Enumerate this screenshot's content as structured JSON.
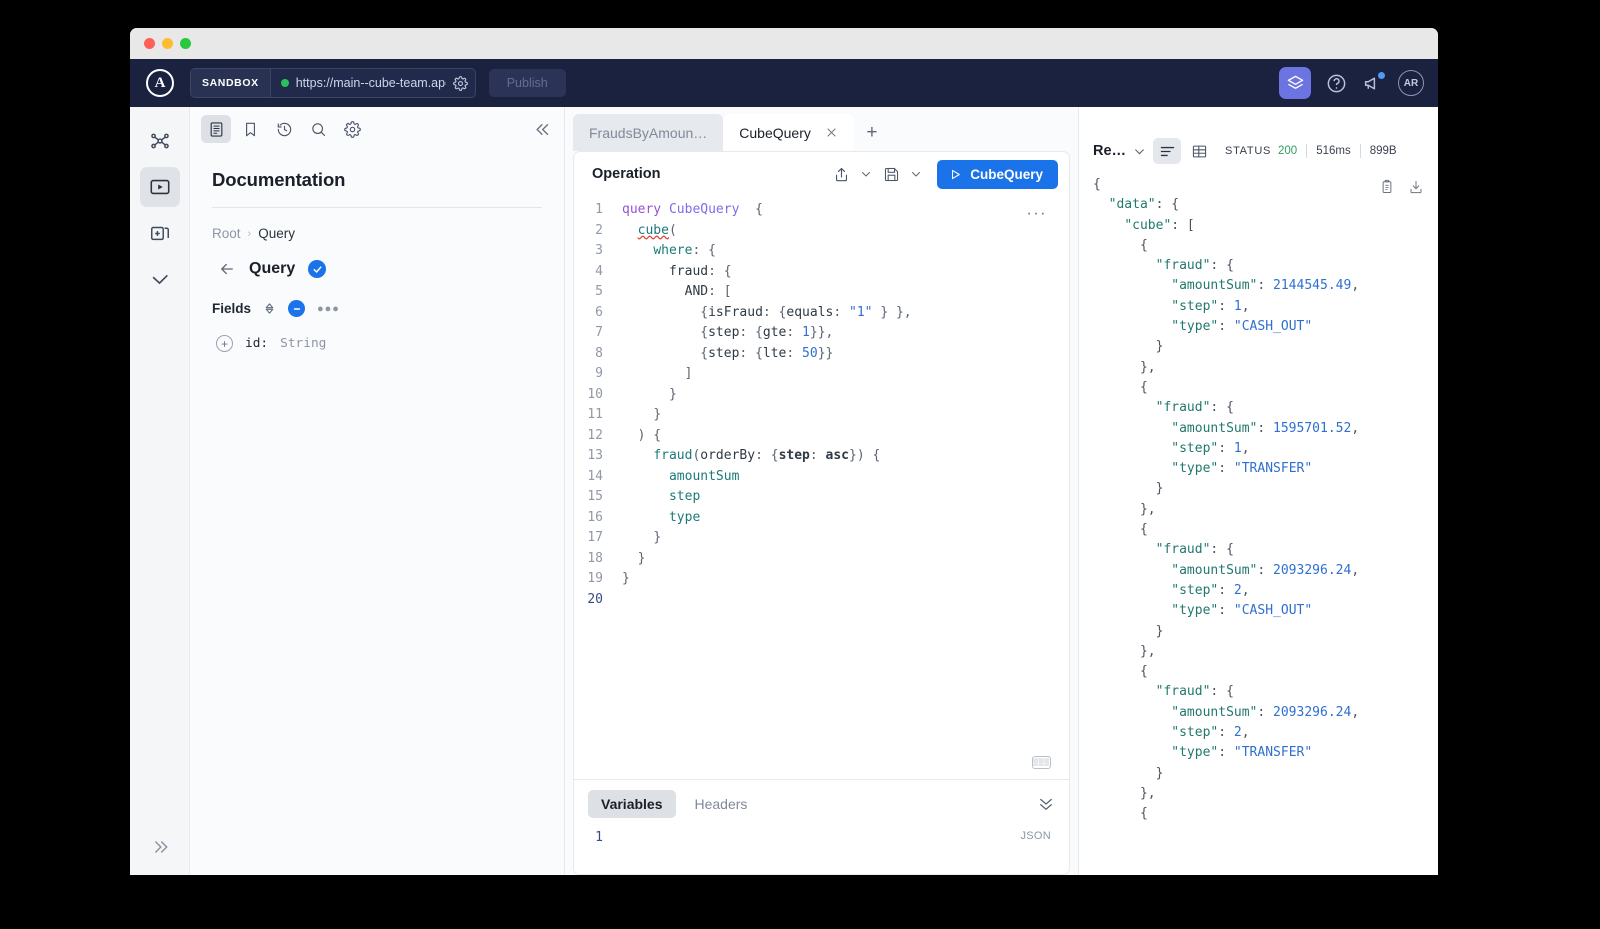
{
  "window": {
    "traffic_lights": [
      "close",
      "minimize",
      "maximize"
    ]
  },
  "appbar": {
    "logo": "apollo-logo",
    "sandbox_label": "SANDBOX",
    "url": "https://main--cube-team.apol",
    "url_settings_icon": "gear-icon",
    "publish_label": "Publish",
    "cube_icon": "cube-icon",
    "help_icon": "help-circle-icon",
    "announcements_icon": "megaphone-icon",
    "avatar_initials": "AR"
  },
  "doc_toolbar": {
    "items": [
      {
        "name": "documentation",
        "icon": "document-icon",
        "active": true
      },
      {
        "name": "saved-operations",
        "icon": "bookmark-icon",
        "active": false
      },
      {
        "name": "history",
        "icon": "history-icon",
        "active": false
      },
      {
        "name": "search",
        "icon": "search-icon",
        "active": false
      },
      {
        "name": "settings",
        "icon": "gear-icon",
        "active": false
      }
    ],
    "collapse_icon": "chevron-double-left-icon"
  },
  "rail": {
    "items": [
      {
        "name": "schema",
        "icon": "graph-icon",
        "active": false
      },
      {
        "name": "explorer",
        "icon": "play-box-icon",
        "active": true
      },
      {
        "name": "changelog",
        "icon": "stacked-cards-icon",
        "active": false
      },
      {
        "name": "checks",
        "icon": "check-icon",
        "active": false
      }
    ],
    "expand_icon": "chevron-double-right-icon"
  },
  "documentation": {
    "title": "Documentation",
    "breadcrumb": {
      "root": "Root",
      "separator": "›",
      "current": "Query"
    },
    "type_name": "Query",
    "type_badge_icon": "check-circle-icon",
    "back_icon": "arrow-left-icon",
    "fields_label": "Fields",
    "sort_icon": "sort-icon",
    "collapse_badge_icon": "minus-circle-icon",
    "more_icon": "ellipsis-icon",
    "fields": [
      {
        "name": "id:",
        "type": "String",
        "add_icon": "plus-circle-icon"
      }
    ]
  },
  "tabs": [
    {
      "label": "FraudsByAmoun…",
      "active": false,
      "closable": false
    },
    {
      "label": "CubeQuery",
      "active": true,
      "closable": true,
      "close_icon": "close-icon"
    }
  ],
  "new_tab_icon": "plus-icon",
  "operation": {
    "title": "Operation",
    "share_icon": "share-icon",
    "share_chevron": "chevron-down-icon",
    "save_icon": "floppy-disk-icon",
    "save_chevron": "chevron-down-icon",
    "run_label": "CubeQuery",
    "run_icon": "play-icon",
    "more_icon": "ellipsis-icon",
    "keyboard_icon": "keyboard-icon",
    "line_count": 20,
    "code_lines": [
      {
        "n": 1,
        "html": "<span class='t-kw'>query</span> <span class='t-opname'>CubeQuery</span>  <span class='t-punct'>{</span>"
      },
      {
        "n": 2,
        "html": "  <span class='t-field squiggle'>cube</span><span class='t-punct'>(</span>"
      },
      {
        "n": 3,
        "html": "    <span class='t-field'>where</span><span class='t-punct'>: {</span>"
      },
      {
        "n": 4,
        "html": "      <span class='t-arg'>fraud</span><span class='t-punct'>: {</span>"
      },
      {
        "n": 5,
        "html": "        <span class='t-arg'>AND</span><span class='t-punct'>: [</span>"
      },
      {
        "n": 6,
        "html": "          <span class='t-punct'>{</span><span class='t-arg'>isFraud</span><span class='t-punct'>: {</span><span class='t-arg'>equals</span><span class='t-punct'>: </span><span class='t-str'>\"1\"</span><span class='t-punct'> } },</span>"
      },
      {
        "n": 7,
        "html": "          <span class='t-punct'>{</span><span class='t-arg'>step</span><span class='t-punct'>: {</span><span class='t-arg'>gte</span><span class='t-punct'>: </span><span class='t-num'>1</span><span class='t-punct'>}},</span>"
      },
      {
        "n": 8,
        "html": "          <span class='t-punct'>{</span><span class='t-arg'>step</span><span class='t-punct'>: {</span><span class='t-arg'>lte</span><span class='t-punct'>: </span><span class='t-num'>50</span><span class='t-punct'>}}</span>"
      },
      {
        "n": 9,
        "html": "        <span class='t-punct'>]</span>"
      },
      {
        "n": 10,
        "html": "      <span class='t-punct'>}</span>"
      },
      {
        "n": 11,
        "html": "    <span class='t-punct'>}</span>"
      },
      {
        "n": 12,
        "html": "  <span class='t-punct'>) {</span>"
      },
      {
        "n": 13,
        "html": "    <span class='t-field'>fraud</span><span class='t-punct'>(</span><span class='t-arg'>orderBy</span><span class='t-punct'>: {</span><span class='t-bold'>step</span><span class='t-punct'>: </span><span class='t-bold'>asc</span><span class='t-punct'>}) {</span>"
      },
      {
        "n": 14,
        "html": "      <span class='t-field'>amountSum</span>"
      },
      {
        "n": 15,
        "html": "      <span class='t-field'>step</span>"
      },
      {
        "n": 16,
        "html": "      <span class='t-field'>type</span>"
      },
      {
        "n": 17,
        "html": "    <span class='t-punct'>}</span>"
      },
      {
        "n": 18,
        "html": "  <span class='t-punct'>}</span>"
      },
      {
        "n": 19,
        "html": "<span class='t-punct'>}</span>"
      },
      {
        "n": 20,
        "html": ""
      }
    ]
  },
  "variables": {
    "tabs": [
      {
        "label": "Variables",
        "active": true
      },
      {
        "label": "Headers",
        "active": false
      }
    ],
    "collapse_icon": "chevron-double-down-icon",
    "format_label": "JSON",
    "line_numbers": [
      1
    ],
    "content": ""
  },
  "response": {
    "title": "Re…",
    "title_chevron": "chevron-down-icon",
    "view_toggle": [
      {
        "name": "json-view",
        "icon": "lines-icon",
        "active": true
      },
      {
        "name": "table-view",
        "icon": "table-icon",
        "active": false
      }
    ],
    "status_label": "STATUS",
    "status_code": "200",
    "duration": "516ms",
    "size": "899B",
    "copy_icon": "clipboard-icon",
    "download_icon": "download-icon",
    "json_lines": [
      "<span class='j-punct'>{</span>",
      "  <span class='j-key'>\"data\"</span><span class='j-punct'>: {</span>",
      "    <span class='j-key'>\"cube\"</span><span class='j-punct'>: [</span>",
      "      <span class='j-punct'>{</span>",
      "        <span class='j-key'>\"fraud\"</span><span class='j-punct'>: {</span>",
      "          <span class='j-key'>\"amountSum\"</span><span class='j-punct'>: </span><span class='j-num'>2144545.49</span><span class='j-punct'>,</span>",
      "          <span class='j-key'>\"step\"</span><span class='j-punct'>: </span><span class='j-num'>1</span><span class='j-punct'>,</span>",
      "          <span class='j-key'>\"type\"</span><span class='j-punct'>: </span><span class='j-str'>\"CASH_OUT\"</span>",
      "        <span class='j-punct'>}</span>",
      "      <span class='j-punct'>},</span>",
      "      <span class='j-punct'>{</span>",
      "        <span class='j-key'>\"fraud\"</span><span class='j-punct'>: {</span>",
      "          <span class='j-key'>\"amountSum\"</span><span class='j-punct'>: </span><span class='j-num'>1595701.52</span><span class='j-punct'>,</span>",
      "          <span class='j-key'>\"step\"</span><span class='j-punct'>: </span><span class='j-num'>1</span><span class='j-punct'>,</span>",
      "          <span class='j-key'>\"type\"</span><span class='j-punct'>: </span><span class='j-str'>\"TRANSFER\"</span>",
      "        <span class='j-punct'>}</span>",
      "      <span class='j-punct'>},</span>",
      "      <span class='j-punct'>{</span>",
      "        <span class='j-key'>\"fraud\"</span><span class='j-punct'>: {</span>",
      "          <span class='j-key'>\"amountSum\"</span><span class='j-punct'>: </span><span class='j-num'>2093296.24</span><span class='j-punct'>,</span>",
      "          <span class='j-key'>\"step\"</span><span class='j-punct'>: </span><span class='j-num'>2</span><span class='j-punct'>,</span>",
      "          <span class='j-key'>\"type\"</span><span class='j-punct'>: </span><span class='j-str'>\"CASH_OUT\"</span>",
      "        <span class='j-punct'>}</span>",
      "      <span class='j-punct'>},</span>",
      "      <span class='j-punct'>{</span>",
      "        <span class='j-key'>\"fraud\"</span><span class='j-punct'>: {</span>",
      "          <span class='j-key'>\"amountSum\"</span><span class='j-punct'>: </span><span class='j-num'>2093296.24</span><span class='j-punct'>,</span>",
      "          <span class='j-key'>\"step\"</span><span class='j-punct'>: </span><span class='j-num'>2</span><span class='j-punct'>,</span>",
      "          <span class='j-key'>\"type\"</span><span class='j-punct'>: </span><span class='j-str'>\"TRANSFER\"</span>",
      "        <span class='j-punct'>}</span>",
      "      <span class='j-punct'>},</span>",
      "      <span class='j-punct'>{</span>"
    ]
  },
  "colors": {
    "brand_dark": "#1b2240",
    "accent_blue": "#1a73e8",
    "cube_purple": "#6b74e0",
    "status_green": "#2f9e5e"
  }
}
